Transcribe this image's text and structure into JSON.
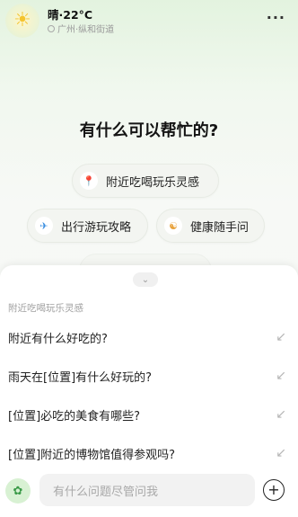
{
  "header": {
    "weather_icon": "sun-icon",
    "temperature": "晴·22°C",
    "location": "广州·纵和街道",
    "more_icon": "more-icon"
  },
  "main": {
    "headline": "有什么可以帮忙的?",
    "chips": [
      {
        "icon": "location-pin-icon",
        "label": "附近吃喝玩乐灵感"
      },
      {
        "icon": "airplane-icon",
        "label": "出行游玩攻略"
      },
      {
        "icon": "meditation-icon",
        "label": "健康随手问"
      }
    ]
  },
  "sheet": {
    "title": "附近吃喝玩乐灵感",
    "questions": [
      "附近有什么好吃的?",
      "雨天在[位置]有什么好玩的?",
      "[位置]必吃的美食有哪些?",
      "[位置]附近的博物馆值得参观吗?"
    ],
    "input_placeholder": "有什么问题尽管问我"
  }
}
